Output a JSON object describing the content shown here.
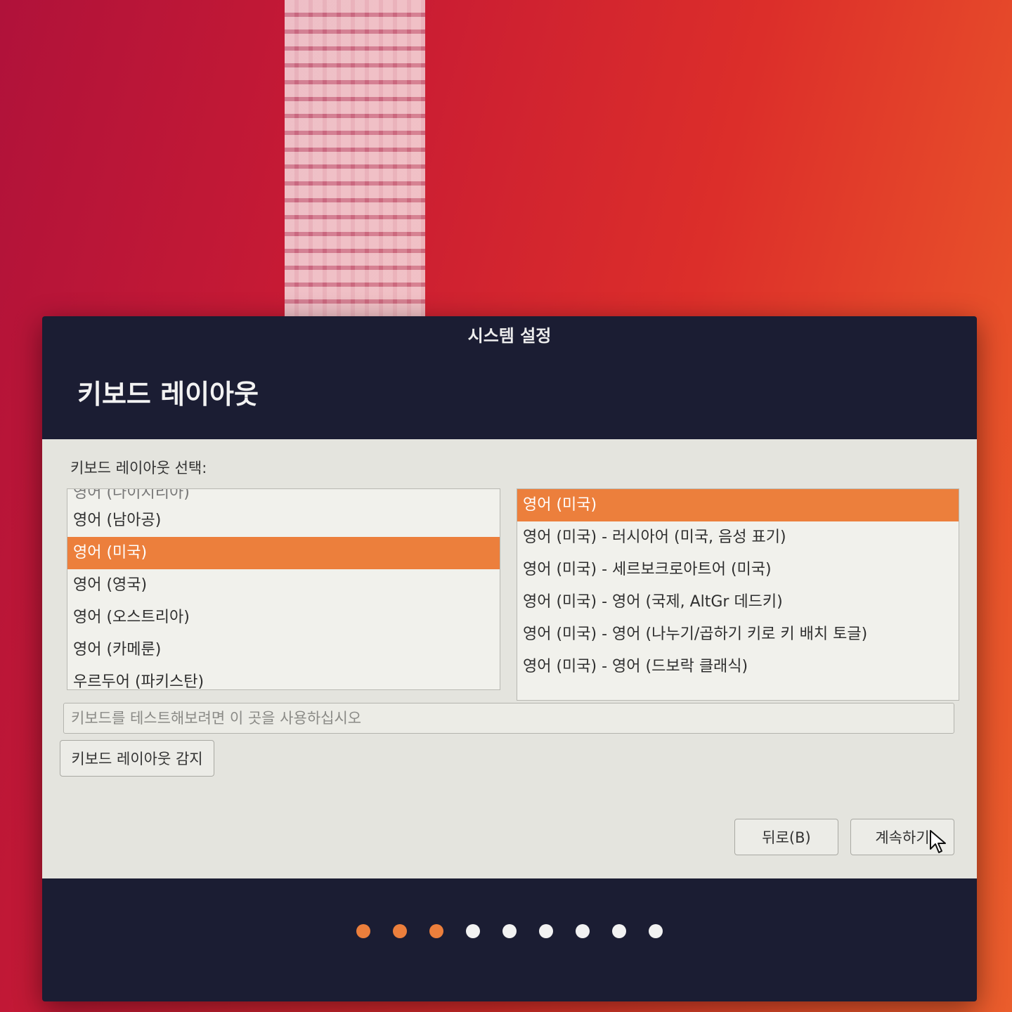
{
  "window": {
    "title": "시스템 설정"
  },
  "page": {
    "heading": "키보드 레이아웃"
  },
  "keyboard": {
    "select_label": "키보드 레이아웃 선택:",
    "layouts": [
      "영어 (나이지리아)",
      "영어 (남아공)",
      "영어 (미국)",
      "영어 (영국)",
      "영어 (오스트리아)",
      "영어 (카메룬)",
      "우르두어 (파키스탄)"
    ],
    "selected_layout": "영어 (미국)",
    "variants": [
      "영어 (미국)",
      "영어 (미국) - 러시아어 (미국, 음성 표기)",
      "영어 (미국) - 세르보크로아트어 (미국)",
      "영어 (미국) - 영어 (국제, AltGr 데드키)",
      "영어 (미국) - 영어 (나누기/곱하기 키로 키 배치 토글)",
      "영어 (미국) - 영어 (드보락 클래식)"
    ],
    "selected_variant": "영어 (미국)",
    "test_placeholder": "키보드를 테스트해보려면 이 곳을 사용하십시오",
    "detect_button": "키보드 레이아웃 감지"
  },
  "nav": {
    "back_label": "뒤로(B)",
    "continue_label": "계속하기"
  },
  "progress": {
    "total_steps": 9,
    "completed_steps": 3
  },
  "colors": {
    "accent": "#ec7f3c",
    "window_bg": "#1b1d33"
  }
}
